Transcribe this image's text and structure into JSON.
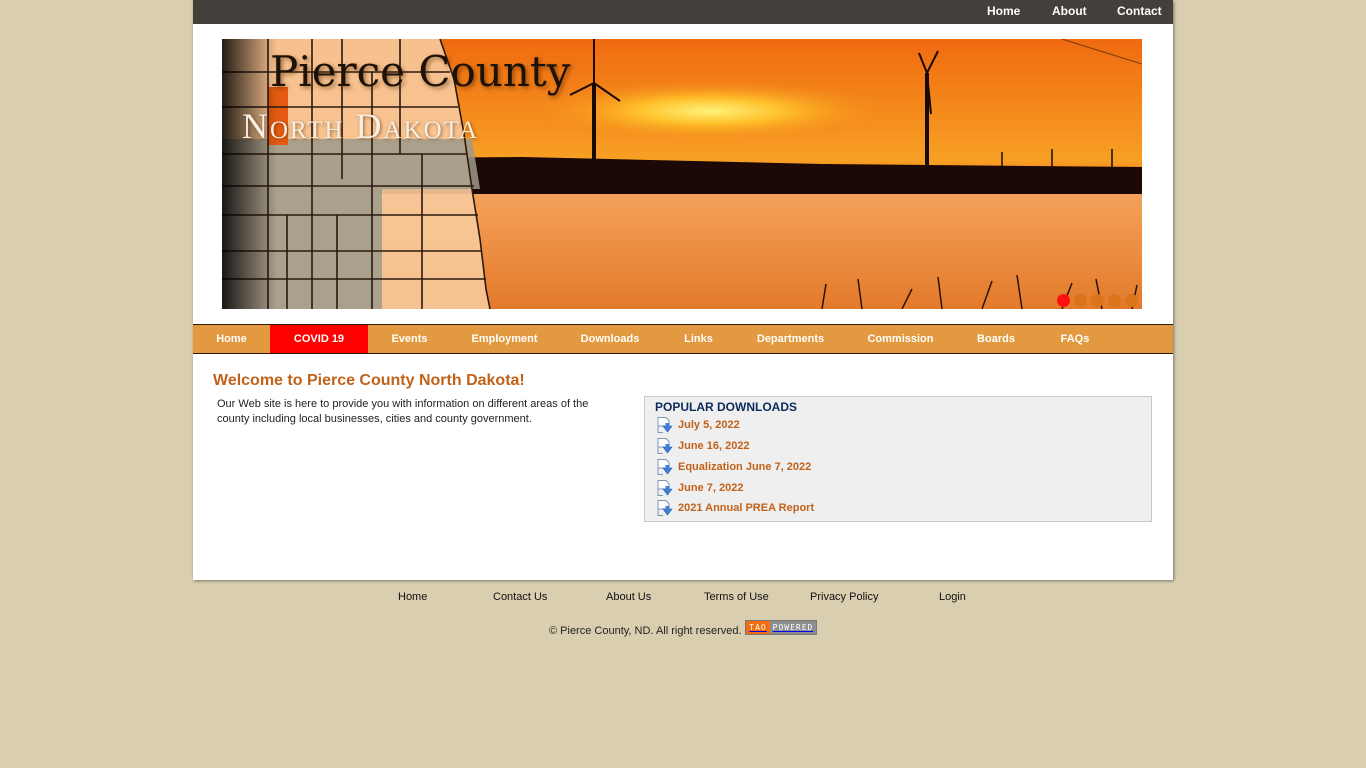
{
  "topnav": {
    "items": [
      {
        "label": "Home"
      },
      {
        "label": "About"
      },
      {
        "label": "Contact"
      }
    ]
  },
  "banner": {
    "title": "Pierce County",
    "subtitle": "North Dakota",
    "slide_count": 5,
    "active_slide": 1,
    "colors": {
      "active_dot": "#ff1010",
      "inactive_dot": "#d9741a"
    }
  },
  "mainnav": {
    "items": [
      {
        "label": "Home"
      },
      {
        "label": "COVID 19",
        "active": true
      },
      {
        "label": "Events"
      },
      {
        "label": "Employment"
      },
      {
        "label": "Downloads"
      },
      {
        "label": "Links"
      },
      {
        "label": "Departments"
      },
      {
        "label": "Commission"
      },
      {
        "label": "Boards"
      },
      {
        "label": "FAQs"
      }
    ],
    "colors": {
      "bar": "#e3993f",
      "active": "#ff0000"
    }
  },
  "main": {
    "heading": "Welcome to Pierce County North Dakota!",
    "intro": "Our Web site is here to provide you with information on different areas of the county including local businesses, cities and county government."
  },
  "downloads": {
    "heading": "POPULAR DOWNLOADS",
    "items": [
      {
        "label": "July 5, 2022",
        "icon": "document-download-icon"
      },
      {
        "label": "June 16, 2022",
        "icon": "document-download-icon"
      },
      {
        "label": "Equalization June 7, 2022",
        "icon": "document-download-icon"
      },
      {
        "label": "June 7, 2022",
        "icon": "document-download-icon"
      },
      {
        "label": "2021 Annual PREA Report",
        "icon": "document-download-icon"
      }
    ]
  },
  "footer": {
    "links": [
      {
        "label": "Home"
      },
      {
        "label": "Contact Us"
      },
      {
        "label": "About Us"
      },
      {
        "label": "Terms of Use"
      },
      {
        "label": "Privacy Policy"
      },
      {
        "label": "Login"
      }
    ],
    "copyright": "© Pierce County, ND. All right reserved.",
    "badge": {
      "left": "TAO",
      "right": "POWERED"
    }
  },
  "theme": {
    "page_bg": "#d9cfb0",
    "topbar_bg": "#433f3a",
    "link_color": "#c0621a",
    "heading_blue": "#0d2b5c"
  }
}
